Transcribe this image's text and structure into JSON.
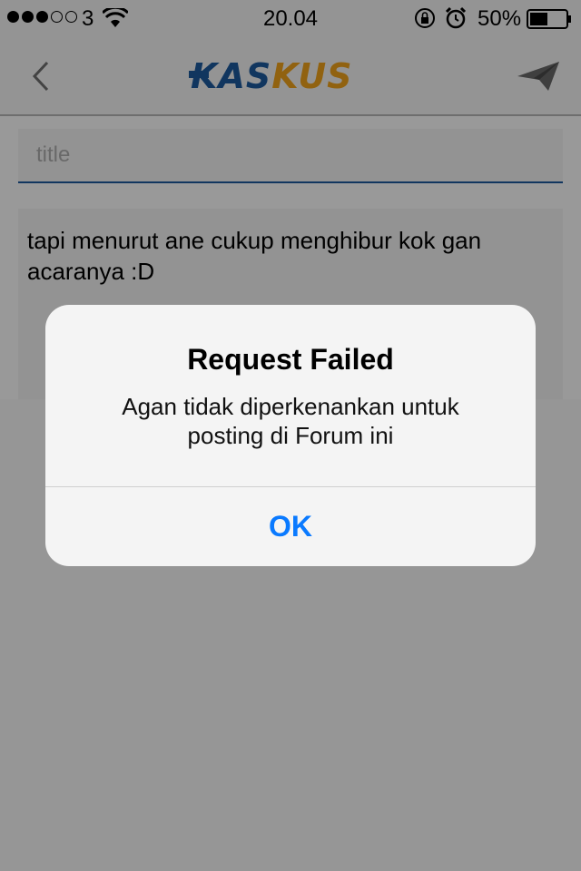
{
  "status_bar": {
    "carrier": "3",
    "time": "20.04",
    "battery_percent": "50%",
    "signal_bars_filled": 3,
    "signal_bars_total": 5,
    "battery_level": 0.5,
    "icons": [
      "signal-dots",
      "wifi-icon",
      "orientation-lock-icon",
      "alarm-icon",
      "battery-icon"
    ]
  },
  "nav": {
    "logo_part1": "KAS",
    "logo_part2": "KUS",
    "back_icon": "chevron-left-icon",
    "send_icon": "paper-plane-icon"
  },
  "compose": {
    "title_placeholder": "title",
    "title_value": "",
    "body_text": "tapi menurut ane cukup menghibur kok gan acaranya :D"
  },
  "alert": {
    "title": "Request Failed",
    "message": "Agan tidak diperkenankan untuk posting di Forum ini",
    "ok_label": "OK"
  },
  "colors": {
    "brand_blue": "#1d5a9e",
    "brand_orange": "#f2a41c",
    "ios_blue": "#0a7aff"
  }
}
